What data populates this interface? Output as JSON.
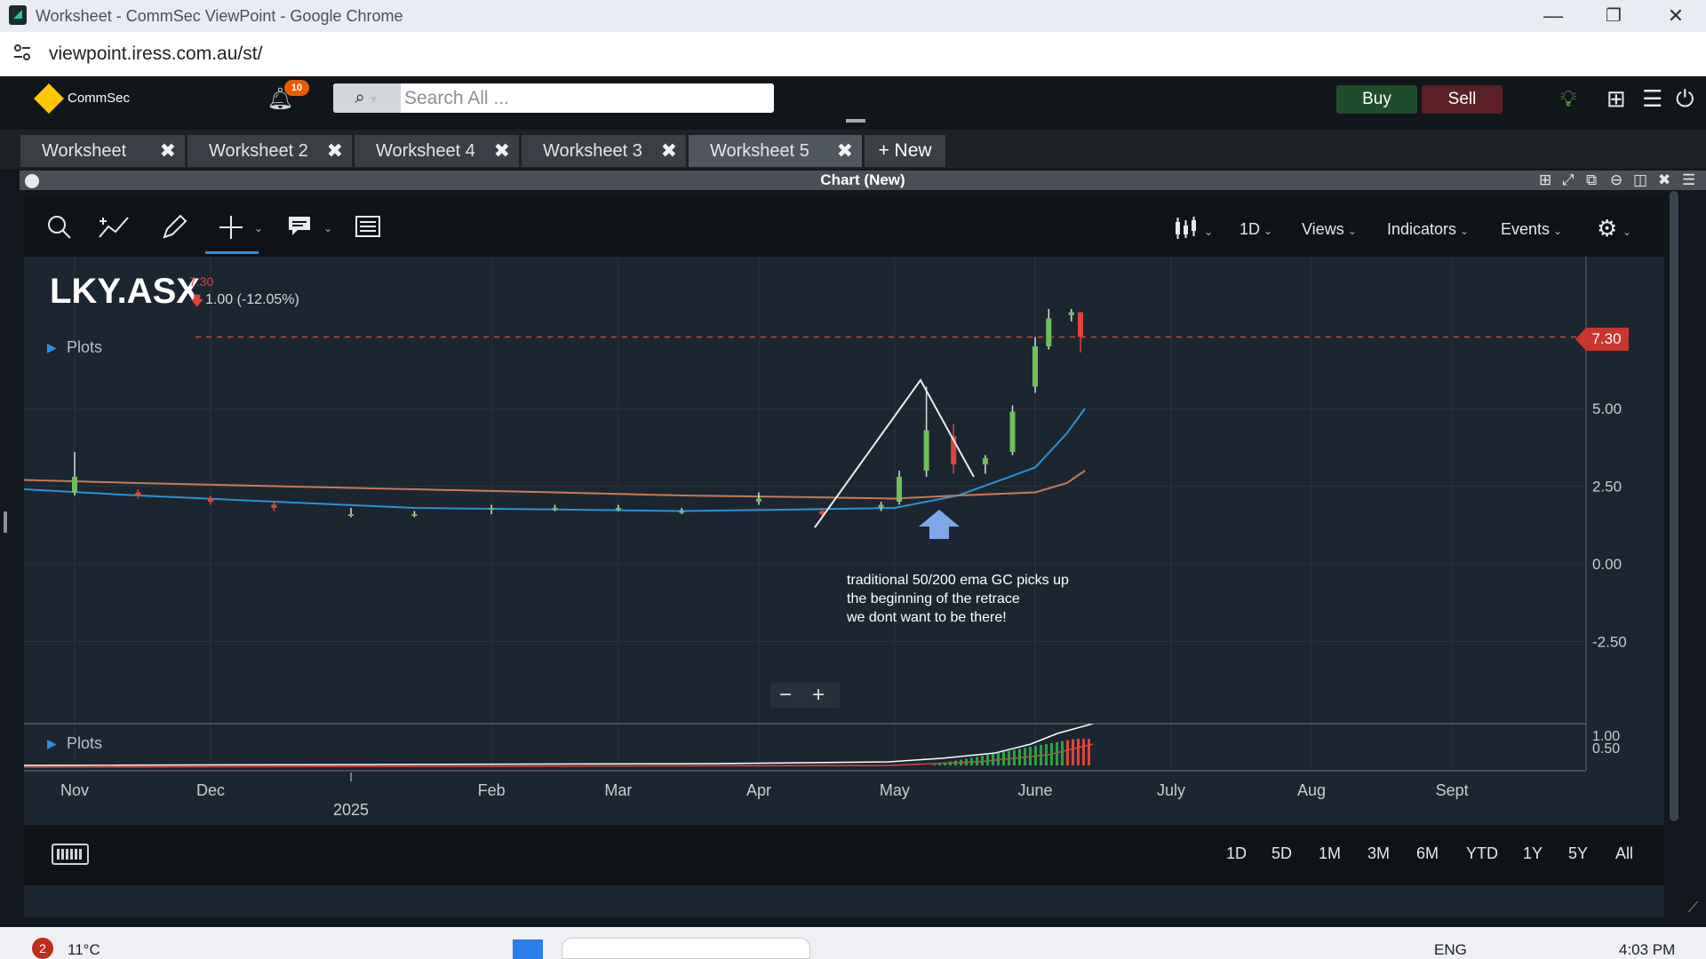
{
  "window": {
    "title": "Worksheet - CommSec ViewPoint - Google Chrome",
    "url": "viewpoint.iress.com.au/st/"
  },
  "header": {
    "brand": "CommSec",
    "notifications": "10",
    "search_placeholder": "Search All ...",
    "buy": "Buy",
    "sell": "Sell"
  },
  "tabs": [
    {
      "label": "Worksheet"
    },
    {
      "label": "Worksheet 2"
    },
    {
      "label": "Worksheet 4"
    },
    {
      "label": "Worksheet 3"
    },
    {
      "label": "Worksheet 5"
    }
  ],
  "new_tab": "+ New",
  "panel": {
    "title": "Chart (New)"
  },
  "toolbar": {
    "interval": "1D",
    "views": "Views",
    "indicators": "Indicators",
    "events": "Events"
  },
  "quote": {
    "symbol": "LKY.ASX",
    "price": "7.30",
    "change": "1.00 (-12.05%)",
    "plots_label": "Plots",
    "last_label": "7.30"
  },
  "annotation": [
    "traditional 50/200 ema GC picks up",
    "the beginning of the retrace",
    "we dont want to be there!"
  ],
  "colors": {
    "up": "#6fbf5a",
    "down": "#e0443a",
    "ema50": "#2a93d5",
    "ema200": "#c87a54",
    "accent": "#2f8fe6"
  },
  "chart_data": {
    "type": "candlestick",
    "symbol": "LKY.ASX",
    "x_tick_labels": [
      "Nov",
      "Dec",
      "2025",
      "Feb",
      "Mar",
      "Apr",
      "May",
      "June",
      "July",
      "Aug",
      "Sept"
    ],
    "y_tick_labels": [
      "5.00",
      "2.50",
      "0.00",
      "-2.50"
    ],
    "ylim": [
      -3.0,
      7.6
    ],
    "last_price": 7.3,
    "candles_approx": [
      {
        "t": "2024-11-01",
        "o": 2.3,
        "h": 3.6,
        "l": 2.2,
        "c": 2.8
      },
      {
        "t": "2024-11-15",
        "o": 2.3,
        "h": 2.4,
        "l": 2.1,
        "c": 2.2
      },
      {
        "t": "2024-12-01",
        "o": 2.1,
        "h": 2.2,
        "l": 1.9,
        "c": 2.0
      },
      {
        "t": "2024-12-15",
        "o": 1.9,
        "h": 2.0,
        "l": 1.7,
        "c": 1.8
      },
      {
        "t": "2025-01-01",
        "o": 1.6,
        "h": 1.8,
        "l": 1.5,
        "c": 1.6
      },
      {
        "t": "2025-01-15",
        "o": 1.6,
        "h": 1.7,
        "l": 1.5,
        "c": 1.6
      },
      {
        "t": "2025-02-01",
        "o": 1.8,
        "h": 1.9,
        "l": 1.6,
        "c": 1.8
      },
      {
        "t": "2025-02-15",
        "o": 1.8,
        "h": 1.9,
        "l": 1.7,
        "c": 1.8
      },
      {
        "t": "2025-03-01",
        "o": 1.8,
        "h": 1.9,
        "l": 1.7,
        "c": 1.8
      },
      {
        "t": "2025-03-15",
        "o": 1.7,
        "h": 1.8,
        "l": 1.6,
        "c": 1.7
      },
      {
        "t": "2025-04-01",
        "o": 2.0,
        "h": 2.3,
        "l": 1.9,
        "c": 2.1
      },
      {
        "t": "2025-04-15",
        "o": 1.7,
        "h": 1.8,
        "l": 1.5,
        "c": 1.6
      },
      {
        "t": "2025-04-28",
        "o": 1.8,
        "h": 2.0,
        "l": 1.7,
        "c": 1.9
      },
      {
        "t": "2025-05-02",
        "o": 2.0,
        "h": 3.0,
        "l": 1.9,
        "c": 2.8
      },
      {
        "t": "2025-05-08",
        "o": 3.0,
        "h": 5.7,
        "l": 2.8,
        "c": 4.3
      },
      {
        "t": "2025-05-14",
        "o": 4.1,
        "h": 4.5,
        "l": 2.9,
        "c": 3.2
      },
      {
        "t": "2025-05-21",
        "o": 3.2,
        "h": 3.5,
        "l": 2.9,
        "c": 3.4
      },
      {
        "t": "2025-05-27",
        "o": 3.6,
        "h": 5.1,
        "l": 3.5,
        "c": 4.9
      },
      {
        "t": "2025-06-01",
        "o": 5.7,
        "h": 7.3,
        "l": 5.5,
        "c": 7.0
      },
      {
        "t": "2025-06-04",
        "o": 7.0,
        "h": 8.2,
        "l": 6.9,
        "c": 7.9
      },
      {
        "t": "2025-06-09",
        "o": 8.0,
        "h": 8.2,
        "l": 7.8,
        "c": 8.1
      },
      {
        "t": "2025-06-11",
        "o": 8.1,
        "h": 8.1,
        "l": 6.8,
        "c": 7.3
      }
    ],
    "series": [
      {
        "name": "EMA 50",
        "values": [
          2.4,
          2.2,
          2.0,
          1.8,
          1.75,
          1.7,
          1.75,
          1.8,
          2.2,
          3.1,
          4.2,
          5.0
        ]
      },
      {
        "name": "EMA 200",
        "values": [
          2.7,
          2.6,
          2.5,
          2.4,
          2.3,
          2.2,
          2.15,
          2.1,
          2.2,
          2.3,
          2.6,
          3.0
        ]
      }
    ],
    "lower_panel": {
      "y_tick_labels": [
        "1.00",
        "0.50"
      ],
      "plots_label": "Plots"
    }
  },
  "ranges": [
    "1D",
    "5D",
    "1M",
    "3M",
    "6M",
    "YTD",
    "1Y",
    "5Y",
    "All"
  ],
  "taskbar": {
    "temp": "11°C",
    "lang": "ENG",
    "time": "4:03 PM",
    "badge": "2"
  }
}
